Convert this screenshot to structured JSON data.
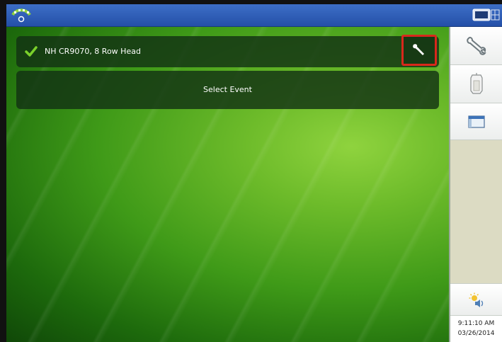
{
  "header": {
    "gps_icon": "gps-satellite-icon",
    "display_icon": "display-settings-icon",
    "bar_color": "#2f5fb8"
  },
  "main": {
    "equipment": {
      "label": "NH CR9070, 8 Row Head",
      "status_icon": "check-icon",
      "action_icon": "wrench-icon",
      "highlight_color": "#d9281c"
    },
    "event_button": {
      "label": "Select Event"
    }
  },
  "sidebar": {
    "buttons": [
      {
        "icon": "wrench-icon"
      },
      {
        "icon": "grain-bin-icon"
      },
      {
        "icon": "window-icon"
      }
    ],
    "status_icon": "sun-speaker-icon",
    "time": "9:11:10 AM",
    "date": "03/26/2014"
  }
}
